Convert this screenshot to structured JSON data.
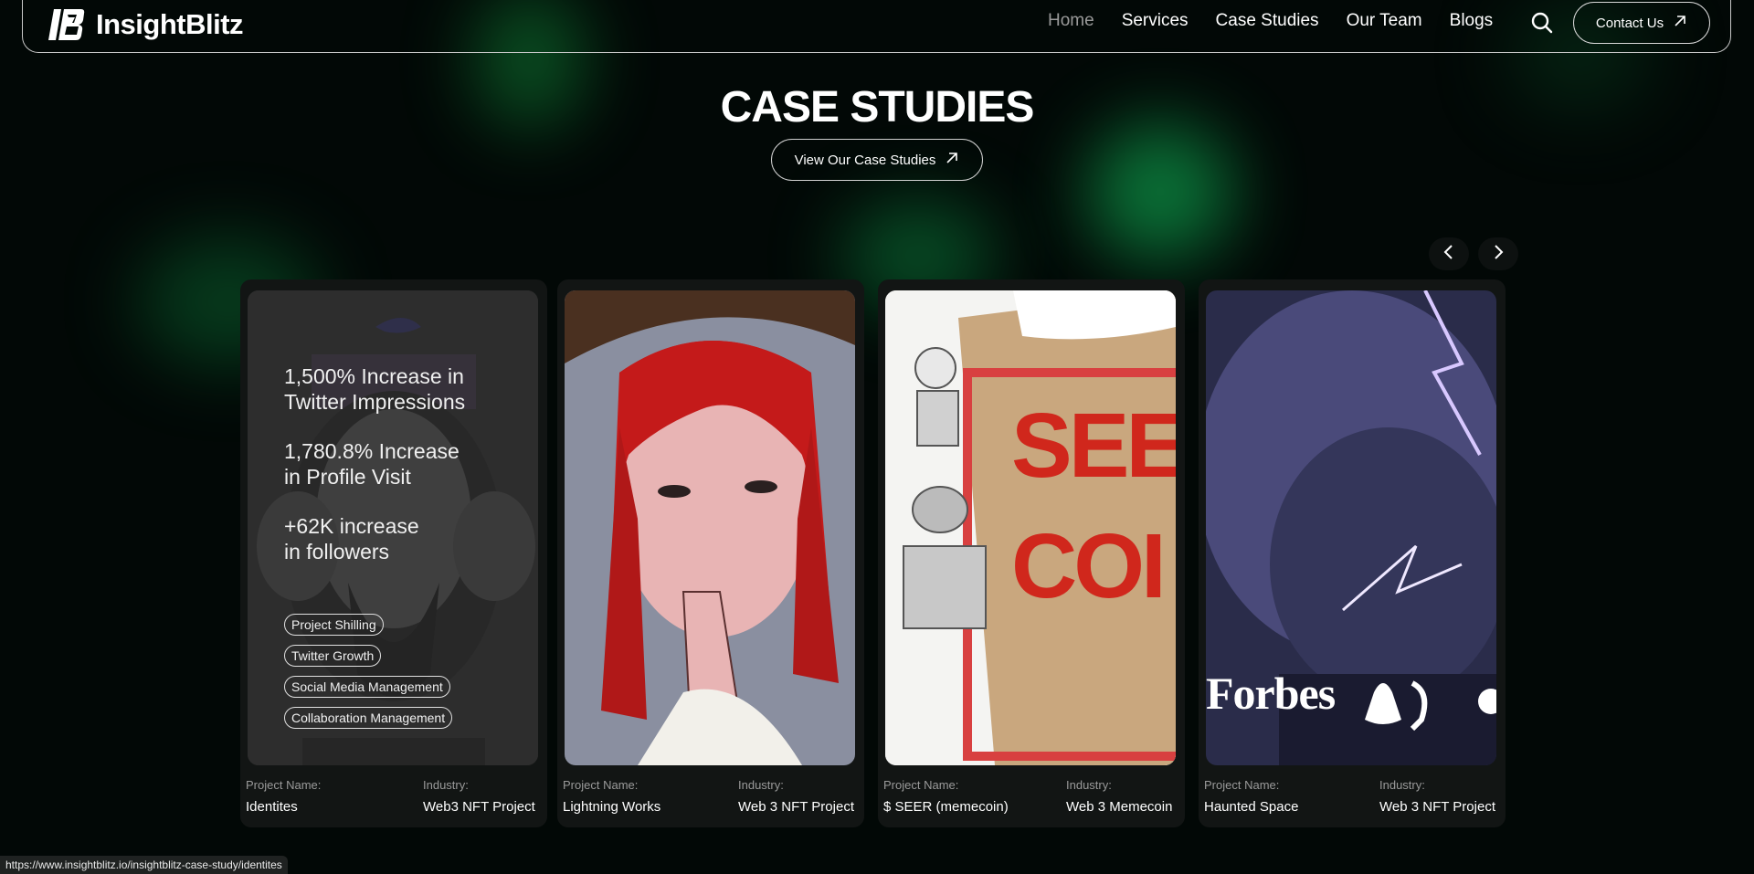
{
  "brand": {
    "name": "InsightBlitz"
  },
  "nav": {
    "items": [
      "Home",
      "Services",
      "Case Studies",
      "Our Team",
      "Blogs"
    ],
    "active": "Home",
    "contact_label": "Contact Us"
  },
  "hero": {
    "title": "CASE STUDIES",
    "cta_label": "View Our Case Studies"
  },
  "cards": [
    {
      "project_label": "Project Name:",
      "project_name": "Identites",
      "industry_label": "Industry:",
      "industry": "Web3 NFT Project",
      "stats": [
        "1,500% Increase in Twitter Impressions",
        "1,780.8% Increase in Profile Visit",
        "+62K increase in followers"
      ],
      "tags": [
        "Project Shilling",
        "Twitter Growth",
        "Social Media Management",
        "Collaboration Management"
      ]
    },
    {
      "project_label": "Project Name:",
      "project_name": "Lightning Works",
      "industry_label": "Industry:",
      "industry": "Web 3 NFT Project"
    },
    {
      "project_label": "Project Name:",
      "project_name": "$ SEER (memecoin)",
      "industry_label": "Industry:",
      "industry": "Web 3 Memecoin",
      "image_text": [
        "SEEI",
        "COI"
      ]
    },
    {
      "project_label": "Project Name:",
      "project_name": "Haunted Space",
      "industry_label": "Industry:",
      "industry": "Web 3 NFT Project",
      "image_text": [
        "Forbes"
      ]
    }
  ],
  "status_url": "https://www.insightblitz.io/insightblitz-case-study/identites",
  "colors": {
    "background": "#020806",
    "glow": "#0d8f45",
    "card": "#121514",
    "stamp_red": "#d0271c"
  }
}
